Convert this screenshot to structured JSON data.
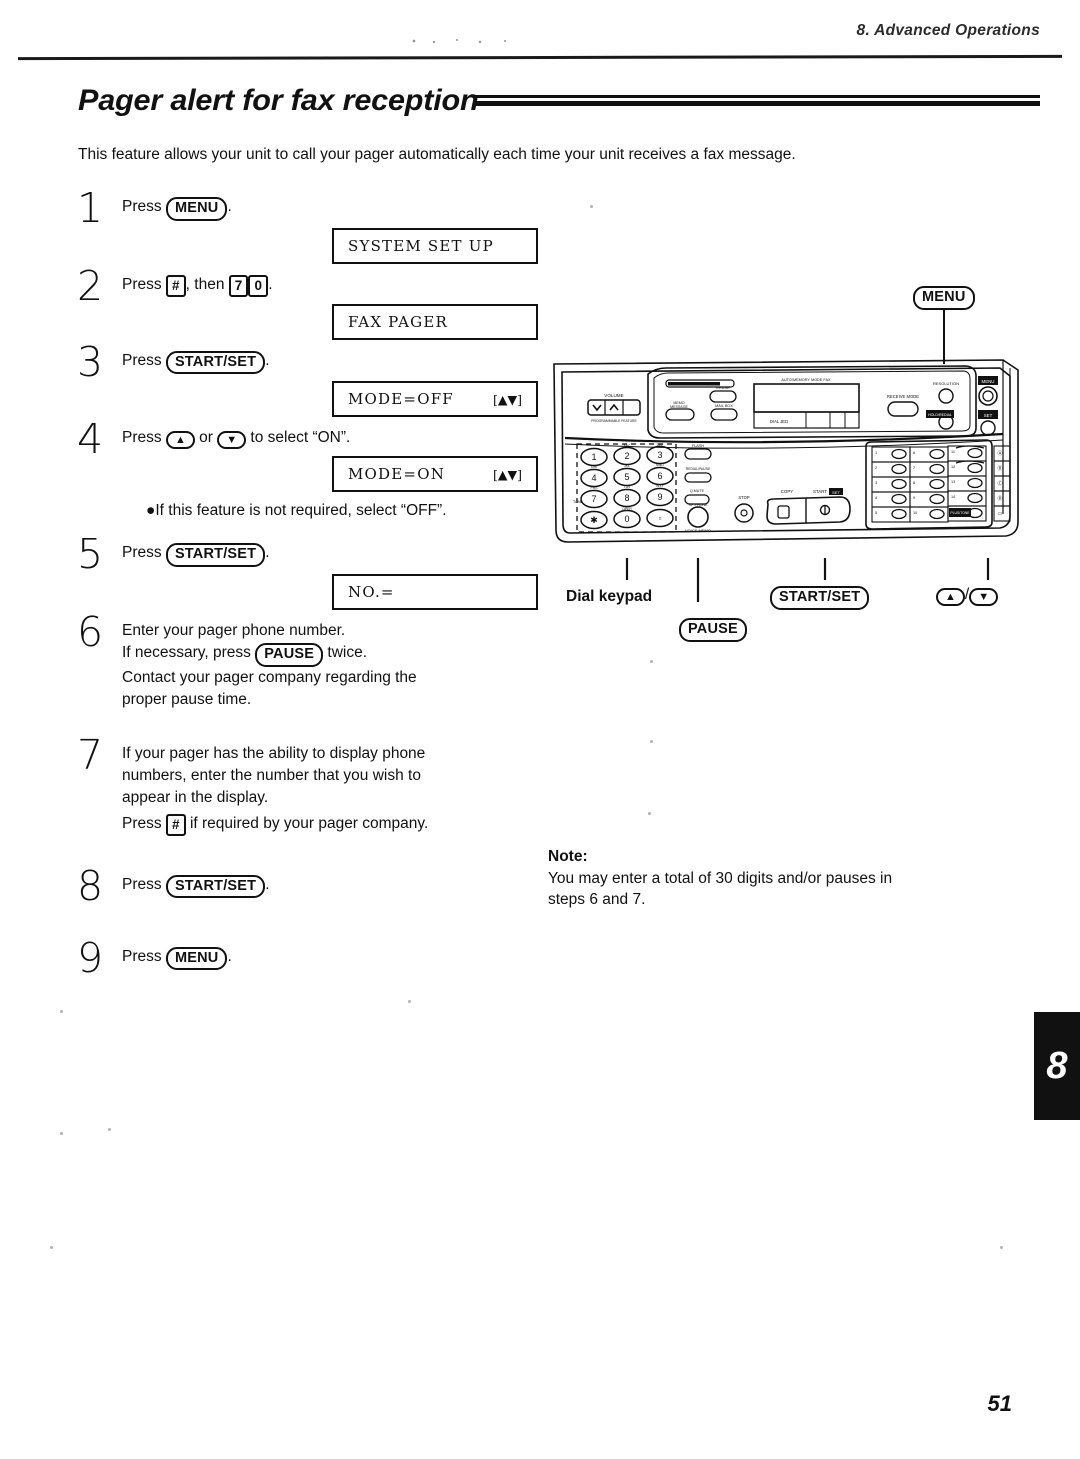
{
  "header": {
    "chapter_label": "8.  Advanced Operations"
  },
  "title": "Pager alert for fax reception",
  "intro": "This feature allows your unit to call your pager automatically each time your unit receives a fax message.",
  "steps": [
    {
      "number": "1",
      "text_before": "Press ",
      "key": "MENU",
      "text_after": ".",
      "display": {
        "main": "SYSTEM SET UP",
        "arrows": ""
      }
    },
    {
      "number": "2",
      "text_before": "Press ",
      "key": "#",
      "text_mid": ", then ",
      "key2": "7",
      "key3": "0",
      "text_after": ".",
      "display": {
        "main": "FAX PAGER",
        "arrows": ""
      }
    },
    {
      "number": "3",
      "text_before": "Press ",
      "key": "START/SET",
      "text_after": ".",
      "display": {
        "main": "MODE=OFF",
        "arrows": "[▲▼]"
      }
    },
    {
      "number": "4",
      "text_before": "Press ",
      "key": "▲",
      "text_mid": " or ",
      "key2": "▼",
      "text_after": " to select “ON”.",
      "display": {
        "main": "MODE=ON",
        "arrows": "[▲▼]"
      },
      "bullet": "●If this feature is not required, select “OFF”."
    },
    {
      "number": "5",
      "text_before": "Press ",
      "key": "START/SET",
      "text_after": ".",
      "display": {
        "main": "NO.=",
        "arrows": ""
      }
    },
    {
      "number": "6",
      "line1": "Enter your pager phone number.",
      "line2_before": "If necessary, press ",
      "line2_key": "PAUSE",
      "line2_after": " twice.",
      "line3": "Contact your pager company regarding the",
      "line4": "proper pause time."
    },
    {
      "number": "7",
      "line1": "If your pager has the ability to display phone",
      "line2": "numbers, enter the number that you wish to",
      "line3": "appear in the display.",
      "line4_before": "Press ",
      "line4_key": "#",
      "line4_after": " if required by your pager company."
    },
    {
      "number": "8",
      "text_before": "Press ",
      "key": "START/SET",
      "text_after": "."
    },
    {
      "number": "9",
      "text_before": "Press ",
      "key": "MENU",
      "text_after": "."
    }
  ],
  "illustration": {
    "menu_callout": "MENU",
    "callouts": [
      {
        "label": "Dial keypad",
        "style": "plain"
      },
      {
        "label": "PAUSE",
        "style": "key"
      },
      {
        "label": "START/SET",
        "style": "key"
      },
      {
        "label": "▲",
        "style": "key"
      },
      {
        "label": "▼",
        "style": "key"
      },
      {
        "label": "/",
        "style": "plain"
      }
    ],
    "panel": {
      "volume_label": "VOLUME",
      "volume_sub": "PROGRAMMABLE FEATURE",
      "answer_on_label": "ANSWER ON",
      "erase_label": "ERASE",
      "memo_label": "MEMO MESSAGE",
      "mail_box_label": "MAIL BOX",
      "display_top_label": "AUTO/MEMORY  MODE   FAX",
      "dial_jed_label": "DIAL JED",
      "receive_mode_label": "RECEIVE MODE",
      "resolution_label": "RESOLUTION",
      "hold_redial_label": "HOLD/REDIAL",
      "menu_btn_label": "MENU",
      "set_btn_label": "SET",
      "flash_label": "FLASH",
      "tone_label": "TONE",
      "quiet_label": "Q.MUTE",
      "sp_phone_label": "SP-PHONE",
      "voice_memo_label": "VOICE MEMO",
      "stop_label": "STOP",
      "copy_label": "COPY",
      "start_label": "START",
      "start_badge": "SET",
      "keypad": [
        [
          {
            "digit": "1",
            "letters": ""
          },
          {
            "digit": "2",
            "letters": "ABC"
          },
          {
            "digit": "3",
            "letters": "DEF"
          }
        ],
        [
          {
            "digit": "4",
            "letters": "GHI"
          },
          {
            "digit": "5",
            "letters": "JKL"
          },
          {
            "digit": "6",
            "letters": "MNO"
          }
        ],
        [
          {
            "digit": "7",
            "letters": "PRS"
          },
          {
            "digit": "8",
            "letters": "TUV"
          },
          {
            "digit": "9",
            "letters": "WXY"
          }
        ],
        [
          {
            "digit": "✱",
            "letters": ""
          },
          {
            "digit": "0",
            "letters": "OPER"
          },
          {
            "digit": "#",
            "letters": ""
          }
        ]
      ],
      "one_touch": [
        [
          "1",
          "6",
          "11"
        ],
        [
          "2",
          "7",
          "12"
        ],
        [
          "3",
          "8",
          "13"
        ],
        [
          "4",
          "9",
          "14"
        ],
        [
          "5",
          "10",
          "PLUS/TONE"
        ]
      ],
      "station_keys": [
        "A",
        "B",
        "C",
        "D",
        "E"
      ]
    }
  },
  "note": {
    "title": "Note:",
    "line1": "You may enter a total of 30 digits and/or pauses in",
    "line2": "steps 6 and 7."
  },
  "chapter_tab": "8",
  "page_number": "51"
}
